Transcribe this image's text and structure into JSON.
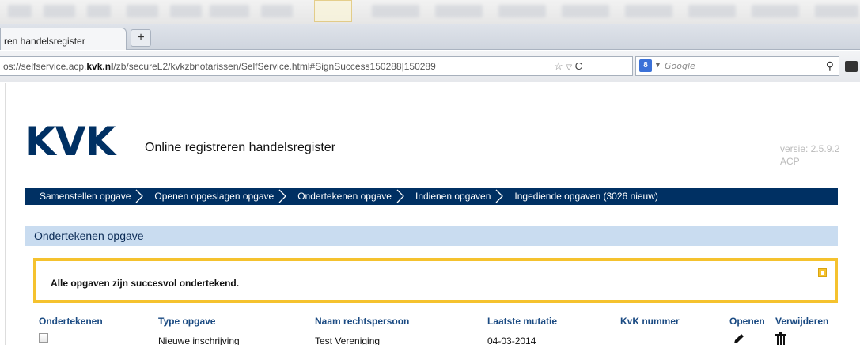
{
  "browser": {
    "tab_title": "ren handelsregister",
    "new_tab": "+",
    "url_prefix": "os://selfservice.acp.",
    "url_domain": "kvk.nl",
    "url_rest": "/zb/secureL2/kvkzbnotarissen/SelfService.html#SignSuccess150288|150289",
    "url_tools": "☆ ▽ C",
    "search_engine_badge": "8",
    "search_placeholder": "Google",
    "icons": [
      "star-icon",
      "dropdown-icon",
      "reload-icon",
      "google-icon",
      "search-icon"
    ]
  },
  "header": {
    "logo": "KVK",
    "title": "Online registreren handelsregister",
    "version_line1": "versie: 2.5.9.2",
    "version_line2": "ACP"
  },
  "nav": {
    "items": [
      {
        "label": "Samenstellen opgave"
      },
      {
        "label": "Openen opgeslagen opgave"
      },
      {
        "label": "Ondertekenen opgave"
      },
      {
        "label": "Indienen opgaven"
      },
      {
        "label": "Ingediende opgaven (3026 nieuw)"
      }
    ]
  },
  "section": {
    "title": "Ondertekenen opgave"
  },
  "notice": {
    "message": "Alle opgaven zijn succesvol ondertekend."
  },
  "table": {
    "headers": [
      "Ondertekenen",
      "Type opgave",
      "Naam rechtspersoon",
      "Laatste mutatie",
      "KvK nummer",
      "Openen",
      "Verwijderen"
    ],
    "rows": [
      {
        "type": "Nieuwe inschrijving",
        "naam": "Test Vereniging",
        "mutatie": "04-03-2014",
        "kvk": ""
      }
    ]
  },
  "colors": {
    "brand_navy": "#003063",
    "section_bg": "#c9dcf0",
    "notice_border": "#f5c22e",
    "header_text": "#1a4a82"
  }
}
